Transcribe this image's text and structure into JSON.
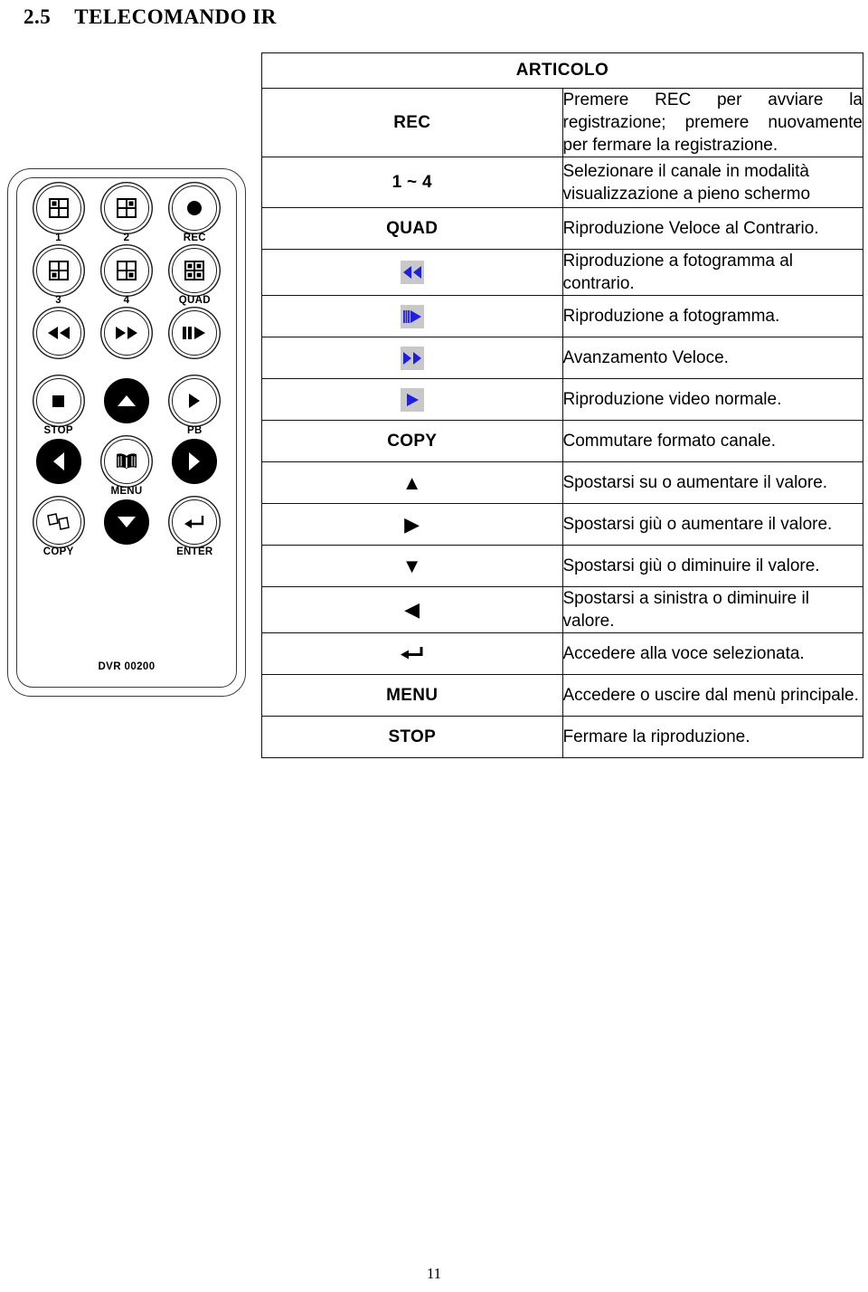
{
  "section": {
    "number": "2.5",
    "title": "TELECOMANDO IR"
  },
  "remote": {
    "model_label": "DVR 00200",
    "buttons": [
      {
        "name": "channel-1",
        "label": "1",
        "icon": "quad-grid-topleft"
      },
      {
        "name": "channel-2",
        "label": "2",
        "icon": "quad-grid-topright"
      },
      {
        "name": "rec",
        "label": "REC",
        "icon": "record-dot"
      },
      {
        "name": "channel-3",
        "label": "3",
        "icon": "quad-grid-bottomleft"
      },
      {
        "name": "channel-4",
        "label": "4",
        "icon": "quad-grid-bottomright"
      },
      {
        "name": "quad",
        "label": "QUAD",
        "icon": "quad-grid-all"
      },
      {
        "name": "rewind",
        "label": "",
        "icon": "rewind"
      },
      {
        "name": "fast-forward",
        "label": "",
        "icon": "fast-forward"
      },
      {
        "name": "pause-play",
        "label": "",
        "icon": "pause-play"
      },
      {
        "name": "stop",
        "label": "STOP",
        "icon": "stop-square"
      },
      {
        "name": "up",
        "label": "",
        "icon": "triangle-up"
      },
      {
        "name": "playback",
        "label": "PB",
        "icon": "triangle-right"
      },
      {
        "name": "left",
        "label": "",
        "icon": "triangle-left"
      },
      {
        "name": "menu",
        "label": "MENU",
        "icon": "book-icon"
      },
      {
        "name": "right",
        "label": "",
        "icon": "triangle-right"
      },
      {
        "name": "copy",
        "label": "COPY",
        "icon": "copy-pages-icon"
      },
      {
        "name": "down",
        "label": "",
        "icon": "triangle-down"
      },
      {
        "name": "enter",
        "label": "ENTER",
        "icon": "enter-arrow"
      }
    ]
  },
  "table": {
    "header": "ARTICOLO",
    "rows": [
      {
        "key": "REC",
        "key_type": "text",
        "icon": "",
        "description": "Premere REC per avviare la registrazione; premere nuovamente per fermare la registrazione.",
        "justify": true
      },
      {
        "key": "1 ~ 4",
        "key_type": "text",
        "icon": "",
        "description": "Selezionare il canale in modalità visualizzazione a pieno schermo",
        "justify": false
      },
      {
        "key": "QUAD",
        "key_type": "text",
        "icon": "",
        "description": "Riproduzione Veloce al Contrario.",
        "justify": false
      },
      {
        "key": "",
        "key_type": "icon",
        "icon": "rewind-blue-icon",
        "description": "Riproduzione a fotogramma al contrario.",
        "justify": false
      },
      {
        "key": "",
        "key_type": "icon",
        "icon": "frame-advance-blue-icon",
        "description": "Riproduzione a fotogramma.",
        "justify": false
      },
      {
        "key": "",
        "key_type": "icon",
        "icon": "fast-forward-blue-icon",
        "description": "Avanzamento Veloce.",
        "justify": false
      },
      {
        "key": "",
        "key_type": "icon",
        "icon": "play-blue-icon",
        "description": "Riproduzione video normale.",
        "justify": false
      },
      {
        "key": "COPY",
        "key_type": "text",
        "icon": "",
        "description": "Commutare formato canale.",
        "justify": false
      },
      {
        "key": "▲",
        "key_type": "glyph",
        "icon": "triangle-up-icon",
        "description": "Spostarsi su o aumentare il valore.",
        "justify": false
      },
      {
        "key": "▶",
        "key_type": "glyph",
        "icon": "triangle-right-icon",
        "description": "Spostarsi giù o aumentare il valore.",
        "justify": false
      },
      {
        "key": "▼",
        "key_type": "glyph",
        "icon": "triangle-down-icon",
        "description": "Spostarsi giù o diminuire il valore.",
        "justify": false
      },
      {
        "key": "◀",
        "key_type": "glyph",
        "icon": "triangle-left-icon",
        "description": "Spostarsi a sinistra o diminuire il valore.",
        "justify": false
      },
      {
        "key": "",
        "key_type": "enter",
        "icon": "enter-arrow-icon",
        "description": "Accedere alla voce selezionata.",
        "justify": false
      },
      {
        "key": "MENU",
        "key_type": "text",
        "icon": "",
        "description": "Accedere o uscire dal menù principale.",
        "justify": false
      },
      {
        "key": "STOP",
        "key_type": "text",
        "icon": "",
        "description": "Fermare la riproduzione.",
        "justify": false
      }
    ]
  },
  "footer": {
    "page_number": "11"
  },
  "colors": {
    "icon_blue": "#2020d8",
    "icon_chip_bg": "#c8c8c8",
    "border": "#111111",
    "text": "#000000"
  }
}
